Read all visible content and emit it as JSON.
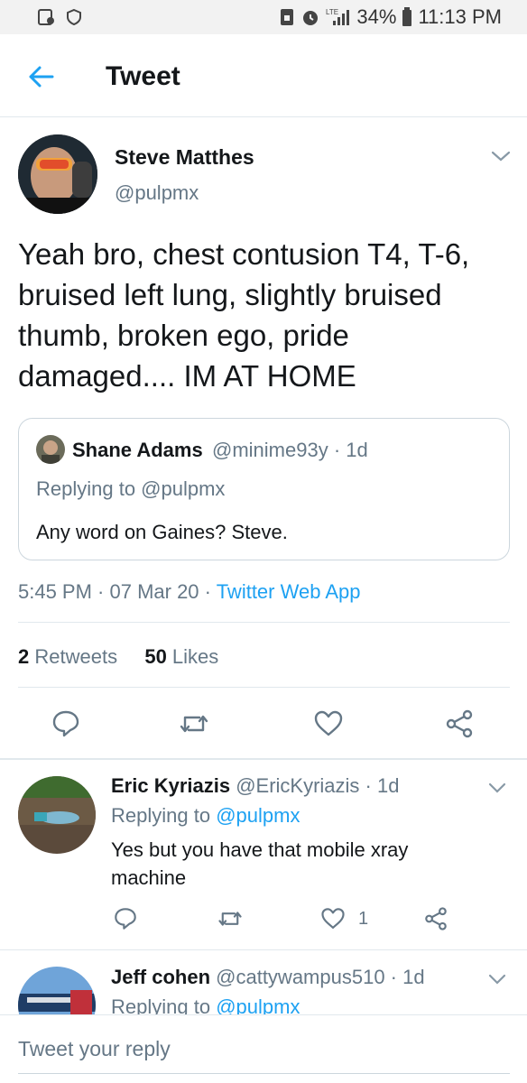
{
  "status_bar": {
    "battery_percent": "34%",
    "time": "11:13 PM",
    "network": "LTE"
  },
  "header": {
    "title": "Tweet"
  },
  "tweet": {
    "author_name": "Steve Matthes",
    "author_handle": "@pulpmx",
    "text": "Yeah bro, chest contusion T4, T-6, bruised left lung, slightly bruised thumb, broken ego, pride damaged.... IM AT HOME",
    "quoted": {
      "author_name": "Shane Adams",
      "meta": "@minime93y · 1d",
      "replying_to": "Replying to @pulpmx",
      "text": "Any word on Gaines? Steve."
    },
    "timestamp": "5:45 PM · 07 Mar 20 · ",
    "source": "Twitter Web App",
    "retweets_count": "2",
    "retweets_label": " Retweets",
    "likes_count": "50",
    "likes_label": " Likes"
  },
  "replies": [
    {
      "author_name": "Eric Kyriazis",
      "meta": " @EricKyriazis · 1d",
      "replying_prefix": "Replying to ",
      "mention": "@pulpmx",
      "text": "Yes but you have that mobile xray machine",
      "like_count": "1"
    },
    {
      "author_name": "Jeff cohen",
      "meta": " @cattywampus510 · 1d",
      "replying_prefix": "Replying to ",
      "mention": "@pulpmx"
    }
  ],
  "reply_bar": {
    "placeholder": "Tweet your reply"
  },
  "colors": {
    "accent": "#1da1f2",
    "secondary_text": "#657786",
    "divider": "#e1e8ed"
  },
  "icons": [
    "back-arrow-icon",
    "chevron-down-icon",
    "reply-icon",
    "retweet-icon",
    "heart-icon",
    "share-icon"
  ]
}
